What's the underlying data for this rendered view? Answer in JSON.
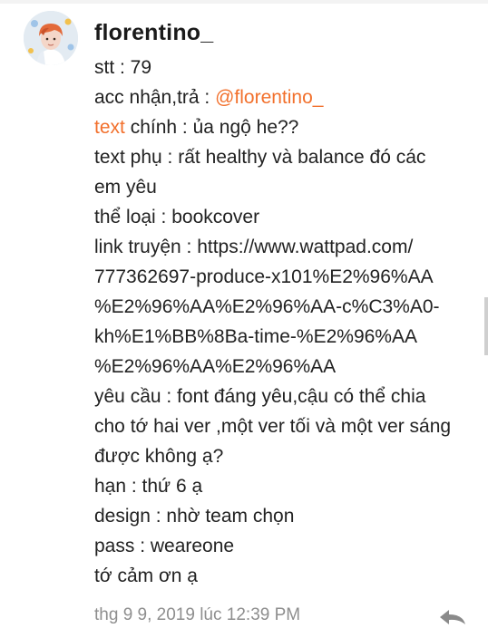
{
  "comment": {
    "username": "florentino_",
    "lines": [
      {
        "prefix": "",
        "accent": "",
        "text": "stt : 79"
      },
      {
        "prefix": "acc nhận,trả : ",
        "accent": "@florentino_",
        "text": ""
      },
      {
        "prefix": "",
        "accent": "text",
        "text": " chính : ủa ngộ he??"
      },
      {
        "prefix": "",
        "accent": "",
        "text": "text phụ : rất healthy và balance đó các"
      },
      {
        "prefix": "",
        "accent": "",
        "text": "em yêu"
      },
      {
        "prefix": "",
        "accent": "",
        "text": "thể loại : bookcover"
      },
      {
        "prefix": "",
        "accent": "",
        "text": "link truyện : https://www.wattpad.com/"
      },
      {
        "prefix": "",
        "accent": "",
        "text": "777362697-produce-x101%E2%96%AA"
      },
      {
        "prefix": "",
        "accent": "",
        "text": "%E2%96%AA%E2%96%AA-c%C3%A0-"
      },
      {
        "prefix": "",
        "accent": "",
        "text": "kh%E1%BB%8Ba-time-%E2%96%AA"
      },
      {
        "prefix": "",
        "accent": "",
        "text": "%E2%96%AA%E2%96%AA"
      },
      {
        "prefix": "",
        "accent": "",
        "text": "yêu cầu : font đáng yêu,cậu có thể chia"
      },
      {
        "prefix": "",
        "accent": "",
        "text": "cho tớ hai ver ,một ver tối và một ver sáng"
      },
      {
        "prefix": "",
        "accent": "",
        "text": "được không ạ?"
      },
      {
        "prefix": "",
        "accent": "",
        "text": "hạn : thứ 6 ạ"
      },
      {
        "prefix": "",
        "accent": "",
        "text": "design : nhờ team chọn"
      },
      {
        "prefix": "",
        "accent": "",
        "text": "pass : weareone"
      },
      {
        "prefix": "",
        "accent": "",
        "text": "tớ cảm ơn ạ"
      }
    ],
    "timestamp": "thg 9 9, 2019 lúc 12:39 PM",
    "reply_icon": "reply-arrow-icon"
  },
  "colors": {
    "accent": "#f2702c",
    "timestamp": "#8e8e8e",
    "text": "#222222"
  }
}
